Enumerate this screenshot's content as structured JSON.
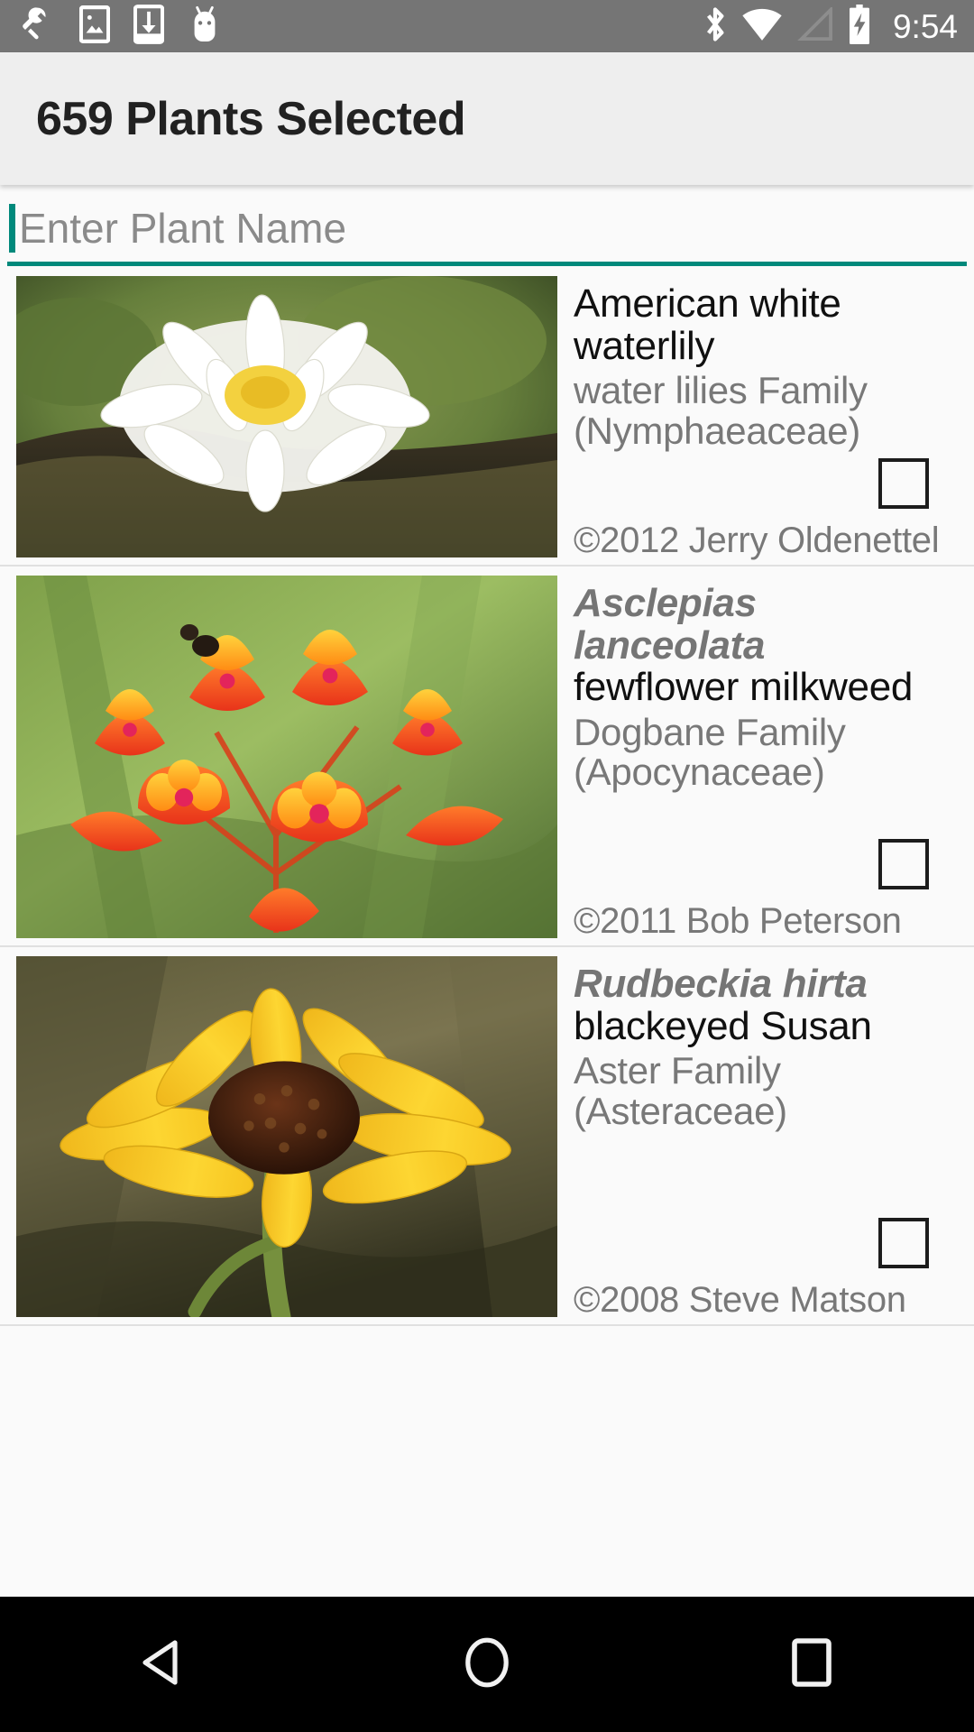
{
  "status_bar": {
    "background": "#757575",
    "left_icons": [
      {
        "name": "wrench-icon",
        "label": "developer tools"
      },
      {
        "name": "screenshot-icon",
        "label": "screenshot"
      },
      {
        "name": "download-icon",
        "label": "download"
      },
      {
        "name": "android-icon",
        "label": "android system"
      }
    ],
    "right_icons": [
      {
        "name": "bluetooth-icon",
        "label": "bluetooth"
      },
      {
        "name": "wifi-icon",
        "label": "wifi"
      },
      {
        "name": "cellular-signal-icon",
        "label": "no signal"
      },
      {
        "name": "battery-charging-icon",
        "label": "battery charging"
      }
    ],
    "clock": "9:54"
  },
  "app_bar": {
    "title": "659 Plants Selected",
    "background": "#eeeeee"
  },
  "search": {
    "value": "",
    "placeholder": "Enter Plant Name",
    "accent_color": "#00897b",
    "focused": true
  },
  "list": {
    "items": [
      {
        "scientific_name": "",
        "common_name": "American white waterlily",
        "family": "water lilies Family (Nymphaeaceae)",
        "credit": "©2012 Jerry Oldenettel",
        "checked": false,
        "image_alt": "white waterlily flower on green lily pad"
      },
      {
        "scientific_name": "Asclepias lanceolata",
        "common_name": "fewflower milkweed",
        "family": "Dogbane Family (Apocynaceae)",
        "credit": "©2011 Bob Peterson",
        "checked": false,
        "image_alt": "cluster of orange red milkweed flowers"
      },
      {
        "scientific_name": "Rudbeckia hirta",
        "common_name": "blackeyed Susan",
        "family": "Aster Family (Asteraceae)",
        "credit": "©2008 Steve Matson",
        "checked": false,
        "image_alt": "yellow blackeyed susan flower with dark center"
      }
    ]
  },
  "nav_bar": {
    "background": "#000000",
    "buttons": [
      {
        "name": "back-button",
        "label": "Back"
      },
      {
        "name": "home-button",
        "label": "Home"
      },
      {
        "name": "recents-button",
        "label": "Recents"
      }
    ]
  }
}
